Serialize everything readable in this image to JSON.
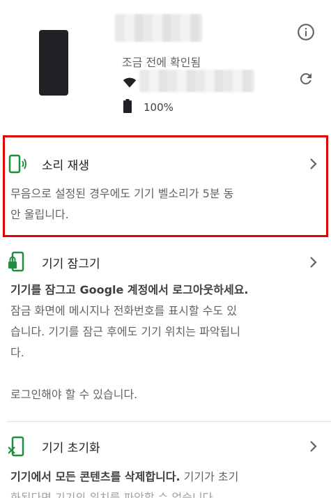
{
  "device": {
    "last_checked": "조금 전에 확인됨",
    "battery": "100%"
  },
  "actions": [
    {
      "title": "소리 재생",
      "description_lines": [
        "무음으로 설정된 경우에도 기기 벨소리가 5분 동",
        "안 울립니다."
      ]
    },
    {
      "title": "기기 잠그기",
      "description_bold": "기기를 잠그고 Google 계정에서 로그아웃하세요.",
      "description_lines": [
        "잠금 화면에 메시지나 전화번호를 표시할 수도 있",
        "습니다. 기기를 잠근 후에도 기기 위치는 파악됩니",
        "다."
      ],
      "note": "로그인해야 할 수 있습니다."
    },
    {
      "title": "기기 초기화",
      "description_bold": "기기에서 모든 콘텐츠를 삭제합니다.",
      "description_rest": " 기기가 초기",
      "description_line2": "화된다면 기기의 위치를 파악할 수 없습니다."
    }
  ],
  "colors": {
    "accent_green": "#1e8e3e",
    "highlight_red": "#e00000",
    "icon_gray": "#5f6368"
  },
  "icons": {
    "info": "info-icon",
    "refresh": "refresh-icon",
    "wifi": "wifi-icon",
    "battery": "battery-icon",
    "sound": "phone-sound-icon",
    "lock": "phone-lock-icon",
    "erase": "phone-erase-icon",
    "chevron": "chevron-right-icon"
  }
}
